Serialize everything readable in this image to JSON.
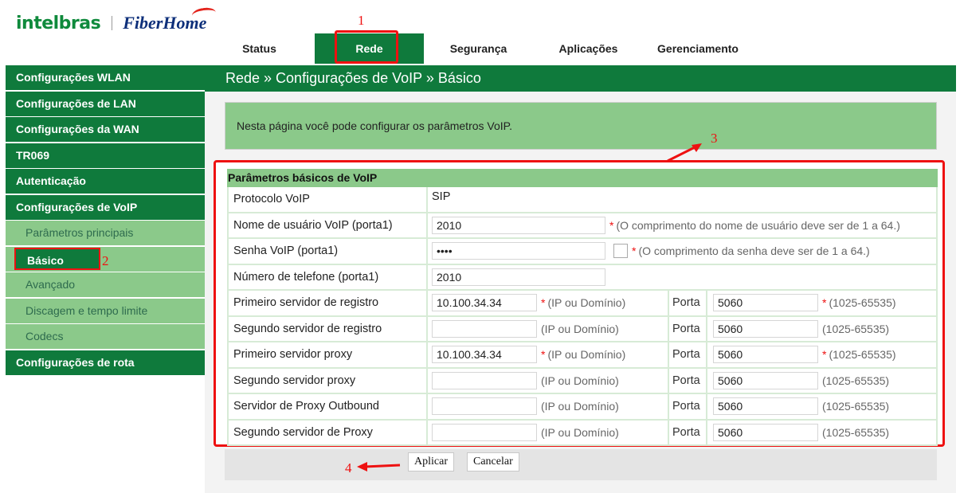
{
  "logo": {
    "brand1": "intelbras",
    "brand2": "FiberHome"
  },
  "tabs": [
    {
      "label": "Status"
    },
    {
      "label": "Rede"
    },
    {
      "label": "Segurança"
    },
    {
      "label": "Aplicações"
    },
    {
      "label": "Gerenciamento"
    }
  ],
  "sidebar": {
    "items": [
      {
        "label": "Configurações WLAN"
      },
      {
        "label": "Configurações de LAN"
      },
      {
        "label": "Configurações da WAN"
      },
      {
        "label": "TR069"
      },
      {
        "label": "Autenticação"
      },
      {
        "label": "Configurações de VoIP"
      }
    ],
    "sub_items": [
      {
        "label": "Parâmetros principais"
      },
      {
        "label": "Básico"
      },
      {
        "label": "Avançado"
      },
      {
        "label": "Discagem e tempo limite"
      },
      {
        "label": "Codecs"
      }
    ],
    "last_item": {
      "label": "Configurações de rota"
    }
  },
  "page_title": "Rede » Configurações de VoIP » Básico",
  "info_text": "Nesta página você pode configurar os parâmetros VoIP.",
  "section_title": "Parâmetros básicos de VoIP",
  "fields": {
    "protocol": {
      "label": "Protocolo VoIP",
      "value": "SIP"
    },
    "username": {
      "label": "Nome de usuário VoIP (porta1)",
      "value": "2010",
      "hint": "(O comprimento do nome de usuário deve ser de 1 a 64.)"
    },
    "password": {
      "label": "Senha VoIP (porta1)",
      "value": "2010",
      "hint": "(O comprimento da senha deve ser de 1 a 64.)"
    },
    "phone": {
      "label": "Número de telefone (porta1)",
      "value": "2010"
    }
  },
  "port_label": "Porta",
  "servers": [
    {
      "label": "Primeiro servidor de registro",
      "value": "10.100.34.34",
      "hint": "(IP ou Domínio)",
      "port": "5060",
      "port_hint": "(1025-65535)",
      "required": true
    },
    {
      "label": "Segundo servidor de registro",
      "value": "",
      "hint": "(IP ou Domínio)",
      "port": "5060",
      "port_hint": "(1025-65535)",
      "required": false
    },
    {
      "label": "Primeiro servidor proxy",
      "value": "10.100.34.34",
      "hint": "(IP ou Domínio)",
      "port": "5060",
      "port_hint": "(1025-65535)",
      "required": true
    },
    {
      "label": "Segundo servidor proxy",
      "value": "",
      "hint": "(IP ou Domínio)",
      "port": "5060",
      "port_hint": "(1025-65535)",
      "required": false
    },
    {
      "label": "Servidor de Proxy Outbound",
      "value": "",
      "hint": "(IP ou Domínio)",
      "port": "5060",
      "port_hint": "(1025-65535)",
      "required": false
    },
    {
      "label": "Segundo servidor de Proxy",
      "value": "",
      "hint": "(IP ou Domínio)",
      "port": "5060",
      "port_hint": "(1025-65535)",
      "required": false
    }
  ],
  "required_mark": "*",
  "buttons": {
    "apply": "Aplicar",
    "cancel": "Cancelar"
  },
  "annotations": {
    "n1": "1",
    "n2": "2",
    "n3": "3",
    "n4": "4"
  },
  "colors": {
    "primary_green": "#0f7a3c",
    "light_green": "#8bc98a",
    "annotation_red": "#e11111"
  }
}
